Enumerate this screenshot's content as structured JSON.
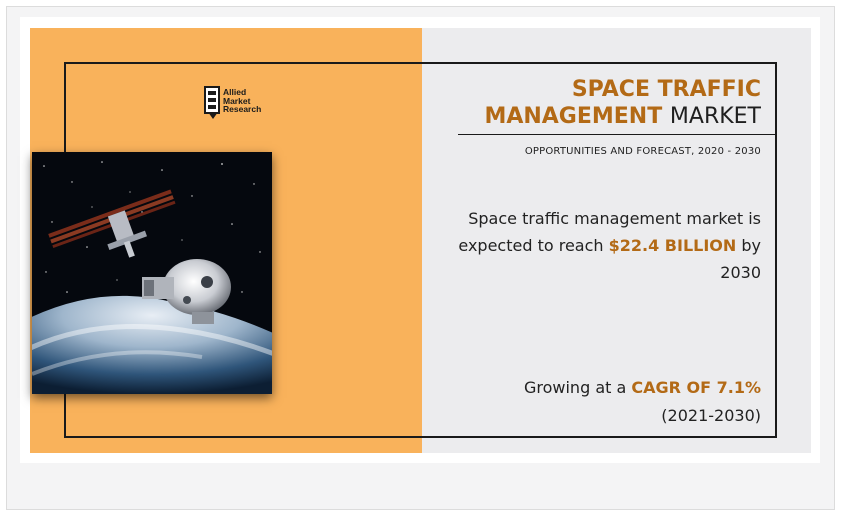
{
  "brand": {
    "logo_lines": [
      "Allied",
      "Market",
      "Research"
    ]
  },
  "headline": {
    "title_highlight_1": "SPACE TRAFFIC",
    "title_highlight_2": "MANAGEMENT",
    "title_plain": "MARKET",
    "subtitle": "OPPORTUNITIES AND FORECAST, 2020 - 2030"
  },
  "stat": {
    "line_1": "Space traffic management market is",
    "prefix_2": "expected to reach ",
    "value": "$22.4 BILLION",
    "suffix_2": " by",
    "line_3": "2030"
  },
  "growth": {
    "prefix": "Growing at a ",
    "value": "CAGR OF 7.1%",
    "period": "(2021-2030)"
  },
  "colors": {
    "accent": "#b36a16",
    "left_panel": "#f9b25b",
    "right_panel": "#ececee"
  }
}
